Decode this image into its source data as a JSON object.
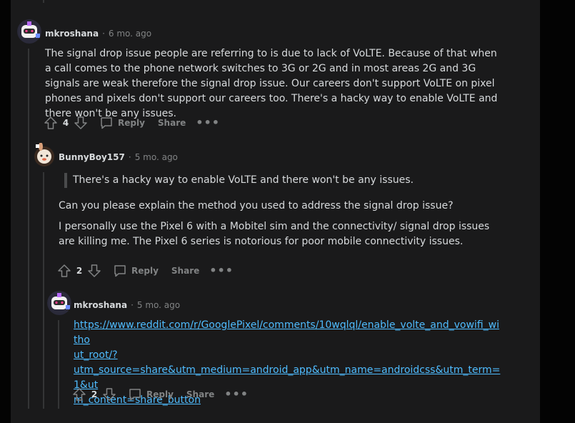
{
  "comments": [
    {
      "username": "mkroshana",
      "time": "6 mo. ago",
      "body": [
        "The signal drop issue people are referring to is due to lack of VoLTE. Because of that when a call comes to the phone network switches to 3G or 2G and in most areas 2G and 3G signals are weak therefore the signal drop issue. Our careers don't support VoLTE on pixel phones and pixels don't support our careers too. There's a hacky way to enable VoLTE and there won't be any issues."
      ],
      "score": "4",
      "reply_label": "Reply",
      "share_label": "Share"
    },
    {
      "username": "BunnyBoy157",
      "time": "5 mo. ago",
      "quote": "There's a hacky way to enable VoLTE and there won't be any issues.",
      "body": [
        "Can you please explain the method you used to address the signal drop issue?",
        "I personally use the Pixel 6 with a Mobitel sim and the connectivity/ signal drop issues are killing me. The Pixel 6 series is notorious for poor mobile connectivity issues."
      ],
      "score": "2",
      "reply_label": "Reply",
      "share_label": "Share"
    },
    {
      "username": "mkroshana",
      "time": "5 mo. ago",
      "link": "https://www.reddit.com/r/GooglePixel/comments/10wqlql/enable_volte_and_vowifi_without_root/?utm_source=share&utm_medium=android_app&utm_name=androidcss&utm_term=1&utm_content=share_button",
      "link_lines": [
        "https://www.reddit.com/r/GooglePixel/comments/10wqlql/enable_volte_and_vowifi_witho",
        "ut_root/?",
        "utm_source=share&utm_medium=android_app&utm_name=androidcss&utm_term=1&ut",
        "m_content=share_button"
      ],
      "score": "2",
      "reply_label": "Reply",
      "share_label": "Share"
    }
  ],
  "separator": "·",
  "more_label": "•••",
  "icons": {
    "upvote": "upvote-icon",
    "downvote": "downvote-icon",
    "reply": "reply-icon",
    "more": "more-options-icon"
  },
  "colors": {
    "panel": "#1a1a1b",
    "text": "#d7dadc",
    "muted": "#818384",
    "link": "#4fbcff",
    "thread": "#343536"
  }
}
